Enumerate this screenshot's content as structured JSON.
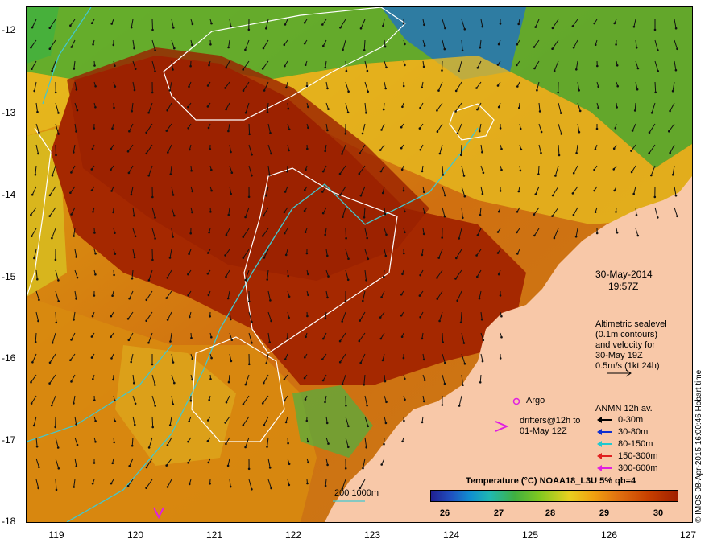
{
  "map": {
    "date": "30-May-2014",
    "time": "19:57Z",
    "altimetry_note": [
      "Altimetric sealevel",
      "(0.1m contours)",
      "and velocity for",
      "30-May 19Z",
      "0.5m/s (1kt 24h)"
    ],
    "argo_label": "Argo",
    "drifters_label": [
      "drifters@12h to",
      "01-May 12Z"
    ],
    "anmn_title": "ANMN 12h av.",
    "anmn_items": [
      {
        "label": "0-30m",
        "color": "#000000"
      },
      {
        "label": "30-80m",
        "color": "#1030d0"
      },
      {
        "label": "80-150m",
        "color": "#20c8d0"
      },
      {
        "label": "150-300m",
        "color": "#e02020"
      },
      {
        "label": "300-600m",
        "color": "#e020e0"
      }
    ],
    "isobath_label": "200  1000m",
    "colorbar_title": "Temperature (°C) NOAA18_L3U 5% qb=4",
    "colorbar_ticks": [
      "26",
      "27",
      "28",
      "29",
      "30"
    ],
    "credit": "© IMOS 08-Apr-2015 16:00:46 Hobart time",
    "lat_ticks": [
      "-12",
      "-13",
      "-14",
      "-15",
      "-16",
      "-17",
      "-18"
    ],
    "lon_ticks": [
      "119",
      "120",
      "121",
      "122",
      "123",
      "124",
      "125",
      "126",
      "127"
    ],
    "colors": {
      "land": "#f8c8a8",
      "warm": "#a52800",
      "mid": "#e08a10",
      "cool": "#20a040",
      "cold": "#1040c0",
      "isobath": "#40c8d0",
      "contour": "#ffffff"
    }
  }
}
